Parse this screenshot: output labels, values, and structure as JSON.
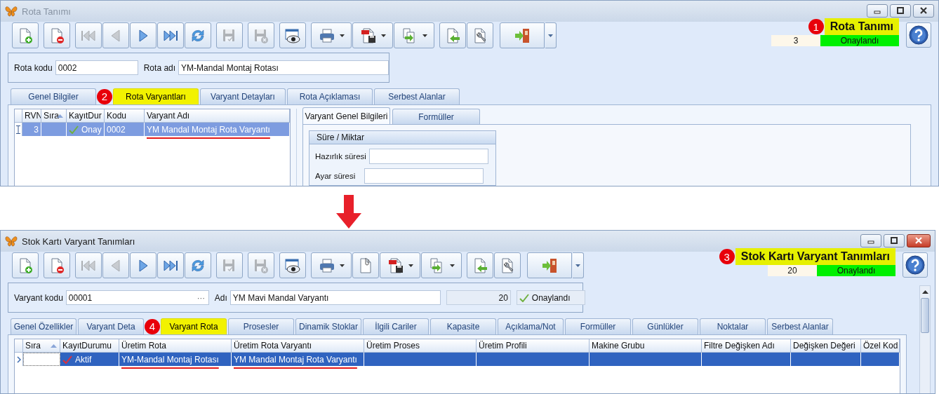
{
  "windows": [
    {
      "title": "Rota Tanımı",
      "active": false,
      "scrollbar": false,
      "toolbar": [
        {
          "kind": "new",
          "disabled": false
        },
        {
          "kind": "delete",
          "disabled": false
        },
        {
          "kind": "first",
          "disabled": true
        },
        {
          "kind": "prev",
          "disabled": true
        },
        {
          "kind": "next",
          "disabled": false
        },
        {
          "kind": "last",
          "disabled": false
        },
        {
          "kind": "refresh",
          "disabled": false
        },
        {
          "kind": "save",
          "disabled": true
        },
        {
          "kind": "cancel",
          "disabled": true
        },
        {
          "kind": "preview",
          "disabled": false
        },
        {
          "kind": "print",
          "disabled": false,
          "dropdown": true
        },
        {
          "kind": "pdf",
          "disabled": false,
          "dropdown": true
        },
        {
          "kind": "export",
          "disabled": false,
          "dropdown": true
        },
        {
          "kind": "import",
          "disabled": false
        },
        {
          "kind": "tools",
          "disabled": false
        },
        {
          "kind": "exit",
          "disabled": false,
          "split": true
        }
      ],
      "header": {
        "marker": "1",
        "title": "Rota Tanımı",
        "count": "3",
        "status": "Onaylandı"
      },
      "fields": [
        {
          "kind": "text",
          "label": "Rota kodu",
          "value": "0002"
        },
        {
          "kind": "text",
          "label": "Rota adı",
          "value": "YM-Mandal Montaj Rotası"
        }
      ],
      "tabs": [
        {
          "label": "Genel Bilgiler",
          "selected": false
        },
        {
          "label": "Rota Varyantları",
          "selected": true,
          "marker": "2"
        },
        {
          "label": "Varyant Detayları",
          "selected": false
        },
        {
          "label": "Rota Açıklaması",
          "selected": false
        },
        {
          "label": "Serbest Alanlar",
          "selected": false
        }
      ],
      "grid": {
        "columns": [
          {
            "label": "RVN",
            "sorted": false
          },
          {
            "label": "Sıra",
            "sorted": true
          },
          {
            "label": "KayıtDur",
            "sorted": false
          },
          {
            "label": "Kodu",
            "sorted": false
          },
          {
            "label": "Varyant Adı",
            "sorted": false
          }
        ],
        "rows": [
          {
            "selected": true,
            "editing": true,
            "cells": [
              {
                "kind": "number",
                "text": "3"
              },
              {},
              {
                "kind": "status",
                "text": "Onay",
                "color": "#6fb040"
              },
              {
                "text": "0002"
              },
              {
                "text": "YM Mandal Montaj Rota Varyantı",
                "underlined": true
              }
            ]
          }
        ]
      },
      "detail": {
        "tabs": [
          {
            "label": "Varyant Genel Bilgileri",
            "selected": true
          },
          {
            "label": "Formüller",
            "selected": false
          }
        ],
        "group": "Süre / Miktar",
        "fields": [
          {
            "label": "Hazırlık süresi"
          },
          {
            "label": "Ayar süresi"
          }
        ]
      }
    },
    {
      "title": "Stok Kartı Varyant Tanımları",
      "active": true,
      "scrollbar": true,
      "toolbar": [
        {
          "kind": "new",
          "disabled": false
        },
        {
          "kind": "delete",
          "disabled": false
        },
        {
          "kind": "first",
          "disabled": true
        },
        {
          "kind": "prev",
          "disabled": true
        },
        {
          "kind": "next",
          "disabled": false
        },
        {
          "kind": "last",
          "disabled": false
        },
        {
          "kind": "refresh",
          "disabled": false
        },
        {
          "kind": "save",
          "disabled": true
        },
        {
          "kind": "cancel",
          "disabled": true
        },
        {
          "kind": "preview",
          "disabled": false
        },
        {
          "kind": "print",
          "disabled": false,
          "dropdown": true
        },
        {
          "kind": "attach",
          "disabled": false
        },
        {
          "kind": "pdf",
          "disabled": false,
          "dropdown": true
        },
        {
          "kind": "export",
          "disabled": false,
          "dropdown": true
        },
        {
          "kind": "import",
          "disabled": false
        },
        {
          "kind": "tools",
          "disabled": false
        },
        {
          "kind": "exit",
          "disabled": false,
          "split": true
        }
      ],
      "header": {
        "marker": "3",
        "title": "Stok Kartı Varyant Tanımları",
        "count": "20",
        "status": "Onaylandı"
      },
      "fields": [
        {
          "kind": "lookup",
          "label": "Varyant kodu",
          "value": "00001",
          "button": "···"
        },
        {
          "kind": "text",
          "label": "Adı",
          "value": "YM Mavi Mandal Varyantı"
        },
        {
          "kind": "readonly",
          "value": "20"
        },
        {
          "kind": "status",
          "value": "Onaylandı"
        }
      ],
      "tabs": [
        {
          "label": "Genel Özellikler",
          "selected": false
        },
        {
          "label": "Varyant Deta",
          "selected": false
        },
        {
          "label": "Varyant Rota",
          "selected": true,
          "marker": "4"
        },
        {
          "label": "Prosesler",
          "selected": false
        },
        {
          "label": "Dinamik Stoklar",
          "selected": false
        },
        {
          "label": "İlgili Cariler",
          "selected": false
        },
        {
          "label": "Kapasite",
          "selected": false
        },
        {
          "label": "Açıklama/Not",
          "selected": false
        },
        {
          "label": "Formüller",
          "selected": false
        },
        {
          "label": "Günlükler",
          "selected": false
        },
        {
          "label": "Noktalar",
          "selected": false
        },
        {
          "label": "Serbest Alanlar",
          "selected": false
        }
      ],
      "grid": {
        "columns": [
          {
            "label": "Sıra",
            "sorted": true
          },
          {
            "label": "KayıtDurumu",
            "sorted": false
          },
          {
            "label": "Üretim Rota",
            "sorted": false
          },
          {
            "label": "Üretim Rota Varyantı",
            "sorted": false
          },
          {
            "label": "Üretim Proses",
            "sorted": false
          },
          {
            "label": "Üretim Profili",
            "sorted": false
          },
          {
            "label": "Makine Grubu",
            "sorted": false
          },
          {
            "label": "Filtre Değişken Adı",
            "sorted": false
          },
          {
            "label": "Değişken Değeri",
            "sorted": false
          },
          {
            "label": "Özel Kod",
            "sorted": false
          }
        ],
        "rows": [
          {
            "selected": true,
            "editing": false,
            "cells": [
              {
                "focused": true
              },
              {
                "kind": "status",
                "text": "Aktif",
                "color": "#e0303a"
              },
              {
                "text": "YM-Mandal Montaj Rotası",
                "underlined": true
              },
              {
                "text": "YM Mandal Montaj Rota Varyantı",
                "underlined": true
              },
              {},
              {},
              {},
              {},
              {},
              {}
            ]
          }
        ]
      }
    }
  ]
}
